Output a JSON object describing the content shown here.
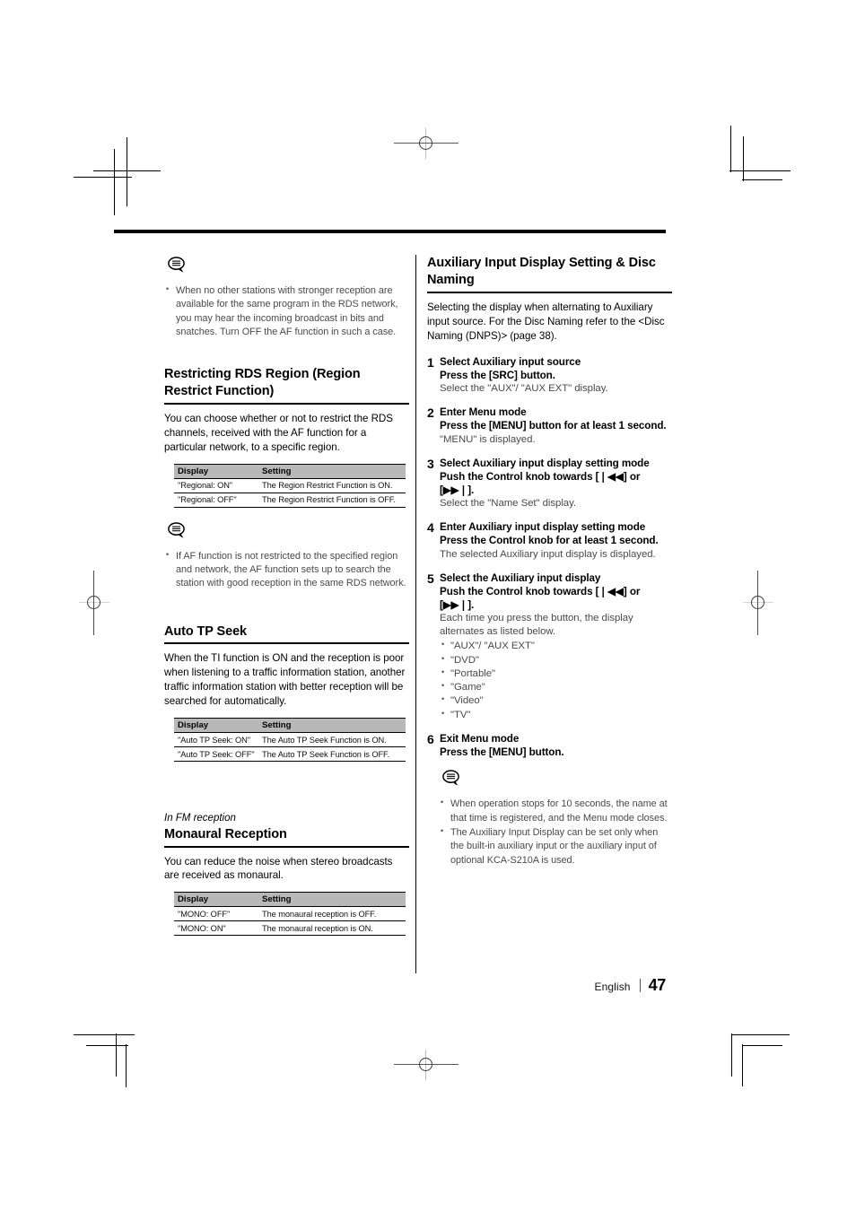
{
  "page": {
    "footer_language": "English",
    "footer_page_number": "47"
  },
  "left_column": {
    "note_top": {
      "icon": "note-speech-bubble-icon",
      "items": [
        "When no other stations with stronger reception are available for the same program in the RDS network, you may hear the incoming broadcast in bits and snatches. Turn OFF the AF function in such a case."
      ]
    },
    "section_rds_region": {
      "heading": "Restricting RDS Region (Region Restrict Function)",
      "body": "You can choose whether or not to restrict the RDS channels, received with the AF function for a particular network, to a specific region.",
      "table": {
        "headers": [
          "Display",
          "Setting"
        ],
        "rows": [
          [
            "\"Regional: ON\"",
            "The Region Restrict Function is ON."
          ],
          [
            "\"Regional: OFF\"",
            "The Region Restrict Function is OFF."
          ]
        ]
      },
      "note": {
        "icon": "note-speech-bubble-icon",
        "items": [
          "If AF function is not restricted to the specified region and network, the AF function sets up to search the station with good reception in the same RDS network."
        ]
      }
    },
    "section_auto_tp_seek": {
      "heading": "Auto TP Seek",
      "body": "When the TI function is ON and the reception is poor when listening to a traffic information station, another traffic information station with better reception will be searched for automatically.",
      "table": {
        "headers": [
          "Display",
          "Setting"
        ],
        "rows": [
          [
            "\"Auto TP Seek: ON\"",
            "The Auto TP Seek Function is ON."
          ],
          [
            "\"Auto TP Seek: OFF\"",
            "The Auto TP Seek Function is OFF."
          ]
        ]
      }
    },
    "section_monaural": {
      "kicker": "In FM reception",
      "heading": "Monaural Reception",
      "body": "You can reduce the noise when stereo broadcasts are received as monaural.",
      "table": {
        "headers": [
          "Display",
          "Setting"
        ],
        "rows": [
          [
            "\"MONO: OFF\"",
            "The monaural reception is OFF."
          ],
          [
            "\"MONO: ON\"",
            "The monaural reception is ON."
          ]
        ]
      }
    }
  },
  "right_column": {
    "section_aux": {
      "heading": "Auxiliary Input Display Setting & Disc Naming",
      "body": "Selecting the display when alternating to Auxiliary input source. For the Disc Naming refer to the <Disc Naming (DNPS)> (page 38).",
      "steps": [
        {
          "num": "1",
          "title": "Select Auxiliary input source",
          "action": "Press the [SRC] button.",
          "desc": "Select the \"AUX\"/ \"AUX EXT\" display."
        },
        {
          "num": "2",
          "title": "Enter Menu mode",
          "action": "Press the [MENU] button for at least 1 second.",
          "desc": "\"MENU\" is displayed."
        },
        {
          "num": "3",
          "title": "Select Auxiliary input display setting mode",
          "action": "Push the Control knob towards [❘◀◀] or [▶▶❘].",
          "desc": "Select the \"Name Set\" display."
        },
        {
          "num": "4",
          "title": "Enter Auxiliary input display setting mode",
          "action": "Press the Control knob for at least 1 second.",
          "desc": "The selected Auxiliary input display is displayed."
        },
        {
          "num": "5",
          "title": "Select the Auxiliary input display",
          "action": "Push the Control knob towards [❘◀◀] or [▶▶❘].",
          "desc": "Each time you press the button, the display alternates as listed below.",
          "list": [
            "\"AUX\"/ \"AUX EXT\"",
            "\"DVD\"",
            "\"Portable\"",
            "\"Game\"",
            "\"Video\"",
            "\"TV\""
          ]
        },
        {
          "num": "6",
          "title": "Exit Menu mode",
          "action": "Press the [MENU] button."
        }
      ],
      "note": {
        "icon": "note-speech-bubble-icon",
        "items": [
          "When operation stops for 10 seconds, the name at that time is registered, and the Menu mode closes.",
          "The Auxiliary Input Display can be set only when the built-in auxiliary input or the auxiliary input of optional KCA-S210A is used."
        ]
      }
    }
  }
}
